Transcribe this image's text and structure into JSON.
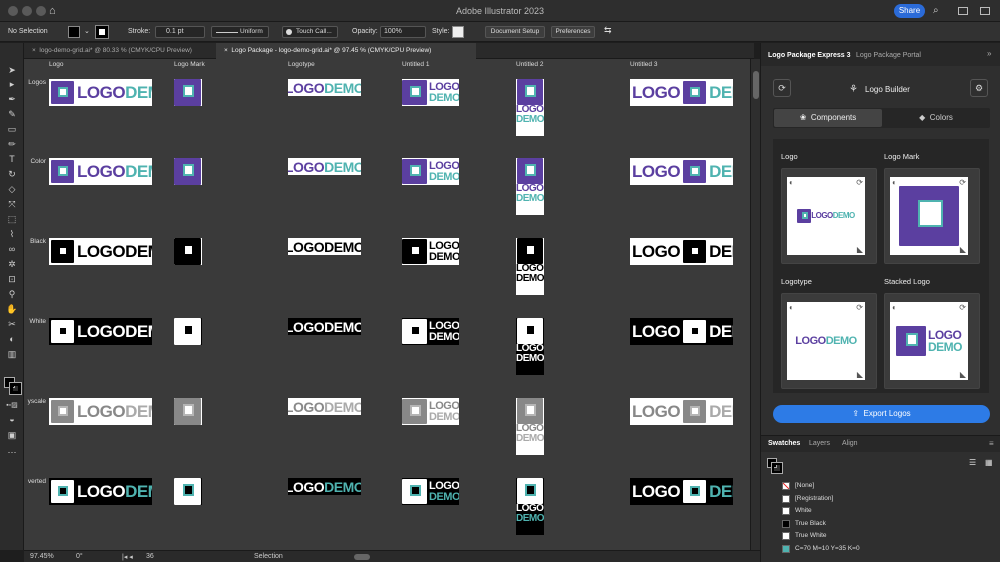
{
  "app": {
    "title": "Adobe Illustrator 2023",
    "share_label": "Share"
  },
  "control_bar": {
    "selection": "No Selection",
    "stroke_label": "Stroke:",
    "stroke_value": "0.1 pt",
    "profile": "Uniform",
    "brush": "Touch Call...",
    "opacity_label": "Opacity:",
    "opacity_value": "100%",
    "style_label": "Style:",
    "doc_setup": "Document Setup",
    "preferences": "Preferences"
  },
  "doc_tabs": [
    {
      "label": "logo-demo-grid.ai* @ 80.33 % (CMYK/CPU Preview)",
      "active": false
    },
    {
      "label": "Logo Package - logo-demo-grid.ai* @ 97.45 % (CMYK/CPU Preview)",
      "active": true
    }
  ],
  "canvas": {
    "columns": [
      "Logo",
      "Logo Mark",
      "Logotype",
      "Untitled 1",
      "Untitled 2",
      "Untitled 3"
    ],
    "rows": [
      "Logos",
      "Color",
      "Black",
      "White",
      "yscale",
      "verted"
    ],
    "wordmark": {
      "logo": "LOGO",
      "demo": "DEMO"
    }
  },
  "status_bar": {
    "zoom": "97.45%",
    "rotation": "0°",
    "artboard": "36",
    "tool": "Selection"
  },
  "panel": {
    "tabs": [
      "Logo Package Express 3",
      "Logo Package Portal"
    ],
    "builder_title": "Logo Builder",
    "sub_tabs": [
      "Components",
      "Colors"
    ],
    "cards": [
      "Logo",
      "Logo Mark",
      "Logotype",
      "Stacked Logo"
    ],
    "card_logo_text": {
      "logo": "LOGO",
      "demo": "DEMO"
    },
    "export_label": "Export Logos"
  },
  "swatches": {
    "tabs": [
      "Swatches",
      "Layers",
      "Align"
    ],
    "items": [
      "[None]",
      "[Registration]",
      "White",
      "True Black",
      "True White",
      "C=70 M=10 Y=35 K=0"
    ]
  },
  "colors": {
    "purple": "#5b3fa0",
    "teal": "#4fb3b0",
    "accent": "#2d7be6"
  }
}
